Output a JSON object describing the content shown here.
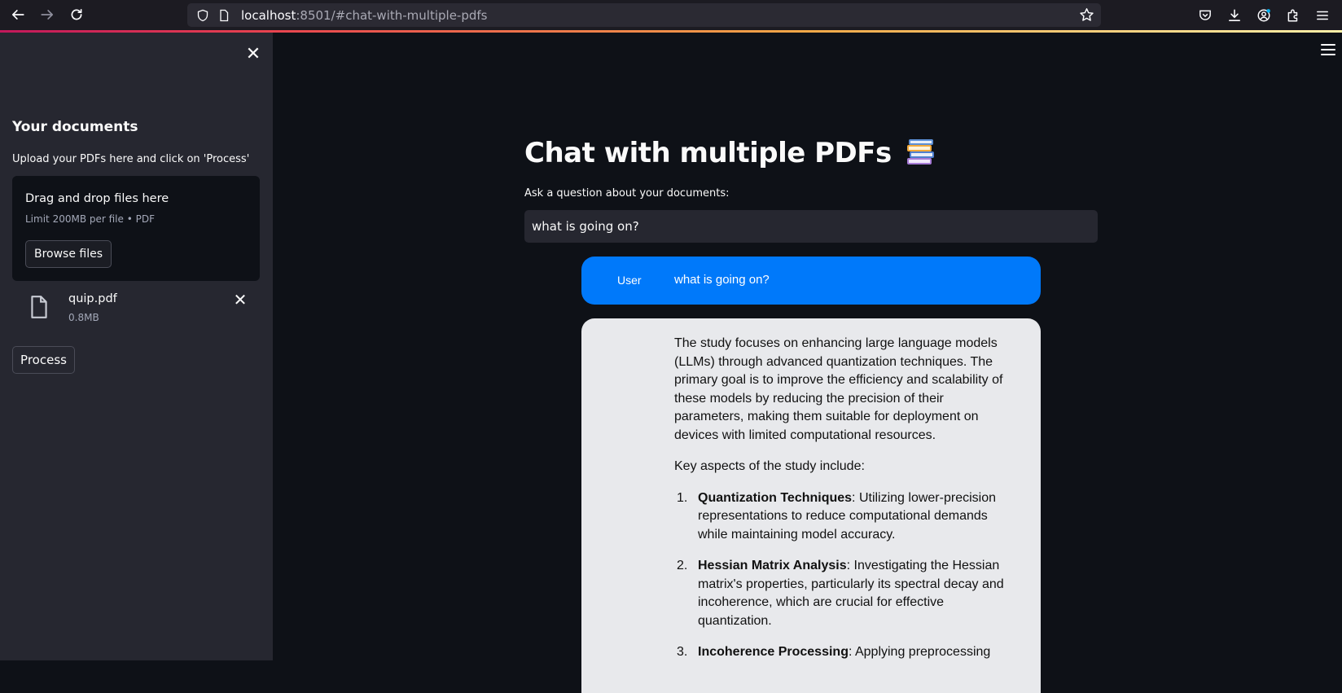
{
  "browser": {
    "url_host": "localhost",
    "url_rest": ":8501/#chat-with-multiple-pdfs"
  },
  "sidebar": {
    "heading": "Your documents",
    "subtitle": "Upload your PDFs here and click on 'Process'",
    "dropzone": {
      "title": "Drag and drop files here",
      "limit": "Limit 200MB per file • PDF",
      "browse_label": "Browse files"
    },
    "files": [
      {
        "name": "quip.pdf",
        "size": "0.8MB"
      }
    ],
    "process_label": "Process"
  },
  "main": {
    "title": "Chat with multiple PDFs",
    "question_label": "Ask a question about your documents:",
    "question_value": "what is going on?"
  },
  "chat": {
    "user": {
      "label": "User",
      "message": "what is going on?"
    },
    "bot": {
      "paragraph1": "The study focuses on enhancing large language models (LLMs) through advanced quantization techniques. The primary goal is to improve the efficiency and scalability of these models by reducing the precision of their parameters, making them suitable for deployment on devices with limited computational resources.",
      "paragraph2": "Key aspects of the study include:",
      "items": [
        {
          "num": "1.",
          "term": "Quantization Techniques",
          "text": ": Utilizing lower-precision representations to reduce computational demands while maintaining model accuracy."
        },
        {
          "num": "2.",
          "term": "Hessian Matrix Analysis",
          "text": ": Investigating the Hessian matrix's properties, particularly its spectral decay and incoherence, which are crucial for effective quantization."
        },
        {
          "num": "3.",
          "term": "Incoherence Processing",
          "text": ": Applying preprocessing"
        }
      ]
    }
  },
  "colors": {
    "user_bubble": "#0079fa",
    "bot_bubble": "#e8e9ec",
    "sidebar_bg": "#262730",
    "main_bg": "#0e1117"
  }
}
